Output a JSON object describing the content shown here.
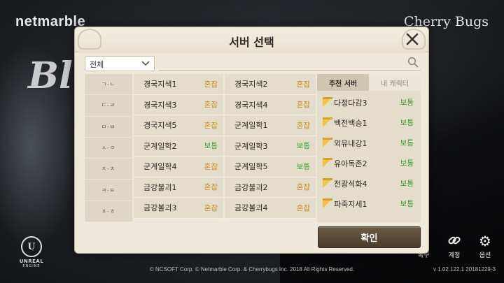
{
  "colors": {
    "status_busy": "#c88a12",
    "status_normal": "#3f9b2f",
    "confirm_button": "#5a4a38",
    "dialog_bg": "#efe9dc"
  },
  "background": {
    "brand_logo": "netmarble",
    "studio_logo": "Cherry Bugs",
    "game_logo_partial": "Bl",
    "engine_logo": {
      "name": "UNREAL",
      "sub": "ENGINE"
    },
    "copyright": "© NCSOFT Corp. © Netmarble Corp. & Cherrybugs Inc. 2018 All Rights Reserved.",
    "version": "v 1.02.122.1  20181229-3",
    "bottom_buttons": [
      {
        "label": "복구",
        "icon": "restore-icon"
      },
      {
        "label": "계정",
        "icon": "link-icon"
      },
      {
        "label": "옵션",
        "icon": "gear-icon"
      }
    ]
  },
  "dialog": {
    "title": "서버 선택",
    "filter": {
      "selected": "전체"
    },
    "index": [
      "ㄱ-ㄴ",
      "ㄷ-ㄹ",
      "ㅁ-ㅂ",
      "ㅅ-ㅇ",
      "ㅈ-ㅊ",
      "ㅋ-ㅌ",
      "ㅍ-ㅎ"
    ],
    "servers": [
      {
        "name": "경국지색1",
        "status": "혼잡"
      },
      {
        "name": "경국지색2",
        "status": "혼잡"
      },
      {
        "name": "경국지색3",
        "status": "혼잡"
      },
      {
        "name": "경국지색4",
        "status": "혼잡"
      },
      {
        "name": "경국지색5",
        "status": "혼잡"
      },
      {
        "name": "군계일학1",
        "status": "혼잡"
      },
      {
        "name": "군계일학2",
        "status": "보통"
      },
      {
        "name": "군계일학3",
        "status": "보통"
      },
      {
        "name": "군계일학4",
        "status": "혼잡"
      },
      {
        "name": "군계일학5",
        "status": "보통"
      },
      {
        "name": "금강불괴1",
        "status": "혼잡"
      },
      {
        "name": "금강불괴2",
        "status": "혼잡"
      },
      {
        "name": "금강불괴3",
        "status": "혼잡"
      },
      {
        "name": "금강불괴4",
        "status": "혼잡"
      }
    ],
    "tabs": {
      "recommended": "추천 서버",
      "my_characters": "내 캐릭터"
    },
    "recommended": [
      {
        "name": "다정다감3",
        "status": "보통"
      },
      {
        "name": "백전백승1",
        "status": "보통"
      },
      {
        "name": "외유내강1",
        "status": "보통"
      },
      {
        "name": "유아독존2",
        "status": "보통"
      },
      {
        "name": "전광석화4",
        "status": "보통"
      },
      {
        "name": "파죽지세1",
        "status": "보통"
      }
    ],
    "confirm_label": "확인"
  }
}
